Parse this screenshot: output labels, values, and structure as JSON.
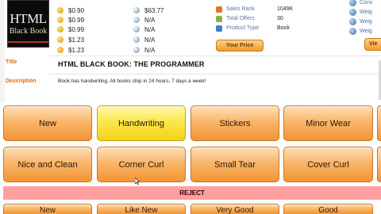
{
  "book_cover": {
    "line1": "HTML",
    "line2": "Black Book"
  },
  "price_list": [
    {
      "value": "$0.90"
    },
    {
      "value": "$0.99"
    },
    {
      "value": "$0.99"
    },
    {
      "value": "$1.23"
    },
    {
      "value": "$1.23"
    }
  ],
  "other_prices": [
    {
      "value": "$63.77"
    },
    {
      "value": "N/A"
    },
    {
      "value": "N/A"
    },
    {
      "value": "N/A"
    },
    {
      "value": "N/A"
    }
  ],
  "details": [
    {
      "label": "Sales Rank",
      "value": "1049K",
      "icon_color": "#e8742a"
    },
    {
      "label": "Total Offers",
      "value": "30",
      "icon_color": "#8bb04a"
    },
    {
      "label": "Product Type",
      "value": "Book",
      "icon_color": "#3f7fc4"
    }
  ],
  "your_price_label": "Your Price",
  "right_links": [
    {
      "label": "Conv"
    },
    {
      "label": "Weig"
    },
    {
      "label": "Weig"
    },
    {
      "label": "Weig"
    }
  ],
  "right_button_label": "Vie",
  "title": {
    "label": "Title",
    "value": "HTML BLACK BOOK: THE PROGRAMMER"
  },
  "description": {
    "label": "Description",
    "value": "Book has handwriting.  All books ship in 24 hours, 7 days a week!"
  },
  "condition_row1": [
    {
      "label": "New",
      "highlighted": false
    },
    {
      "label": "Handwriting",
      "highlighted": true
    },
    {
      "label": "Stickers",
      "highlighted": false
    },
    {
      "label": "Minor Wear",
      "highlighted": false
    }
  ],
  "condition_row2": [
    {
      "label": "Nice and Clean",
      "highlighted": false
    },
    {
      "label": "Corner Curl",
      "highlighted": false
    },
    {
      "label": "Small Tear",
      "highlighted": false
    },
    {
      "label": "Cover Curl",
      "highlighted": false
    }
  ],
  "reject_label": "REJECT",
  "grade_row": [
    {
      "label": "New"
    },
    {
      "label": "Like New"
    },
    {
      "label": "Very Good"
    },
    {
      "label": "Good"
    }
  ],
  "colors": {
    "accent_orange": "#f39433",
    "highlight_yellow": "#fbe84a",
    "reject_red": "#ff9f9f",
    "label_orange": "#e06a00"
  }
}
